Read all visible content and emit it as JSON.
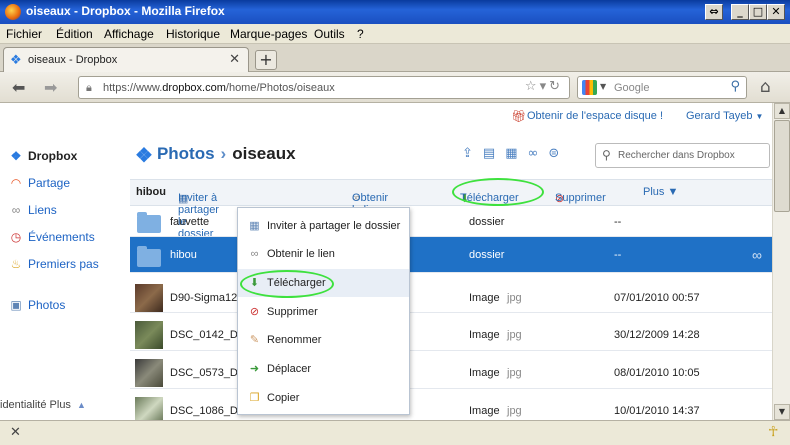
{
  "window": {
    "title": "oiseaux - Dropbox - Mozilla Firefox",
    "buttons": [
      "⇔",
      "_",
      "□",
      "✕"
    ]
  },
  "menu": [
    "Fichier",
    "Édition",
    "Affichage",
    "Historique",
    "Marque-pages",
    "Outils",
    "?"
  ],
  "tab": {
    "label": "oiseaux - Dropbox",
    "close": "✕",
    "new": "+"
  },
  "nav": {
    "url_prefix": "https://www.",
    "url_domain": "dropbox.com",
    "url_path": "/home/Photos/oiseaux",
    "search_placeholder": "Google"
  },
  "top": {
    "space_link": "Obtenir de l'espace disque !",
    "user": "Gerard Tayeb",
    "user_caret": "▼"
  },
  "sidebar": {
    "items": [
      {
        "label": "Dropbox",
        "icon": "dropbox-icon"
      },
      {
        "label": "Partage",
        "icon": "rainbow-icon"
      },
      {
        "label": "Liens",
        "icon": "link-icon"
      },
      {
        "label": "Événements",
        "icon": "clock-icon"
      },
      {
        "label": "Premiers pas",
        "icon": "cake-icon"
      },
      {
        "label": "Photos",
        "icon": "photo-icon"
      }
    ],
    "footer": "identialité Plus",
    "footer_caret": "▲"
  },
  "breadcrumb": {
    "root": "Photos",
    "sep": "›",
    "current": "oiseaux"
  },
  "search_dropbox_placeholder": "Rechercher dans Dropbox",
  "actionbar": {
    "selected": "hibou",
    "share": "Inviter à partager le dossier",
    "link": "Obtenir le lien",
    "download": "Télécharger",
    "delete": "Supprimer",
    "more": "Plus ▼"
  },
  "files": [
    {
      "name": "fauvette",
      "kind": "dossier",
      "ext": "",
      "date": "--",
      "type": "folder"
    },
    {
      "name": "hibou",
      "kind": "dossier",
      "ext": "",
      "date": "--",
      "type": "folder",
      "selected": true
    },
    {
      "name": "D90-Sigma120",
      "kind": "Image",
      "ext": "jpg",
      "date": "07/01/2010 00:57",
      "type": "image"
    },
    {
      "name": "DSC_0142_Dx6",
      "kind": "Image",
      "ext": "jpg",
      "date": "30/12/2009 14:28",
      "type": "image"
    },
    {
      "name": "DSC_0573_Dx6",
      "kind": "Image",
      "ext": "jpg",
      "date": "08/01/2010 10:05",
      "type": "image"
    },
    {
      "name": "DSC_1086_Dx6",
      "kind": "Image",
      "ext": "jpg",
      "date": "10/01/2010 14:37",
      "type": "image"
    }
  ],
  "context_menu": [
    {
      "label": "Inviter à partager le dossier",
      "icon": "share-icon"
    },
    {
      "label": "Obtenir le lien",
      "icon": "link-icon"
    },
    {
      "label": "Télécharger",
      "icon": "download-icon",
      "hover": true
    },
    {
      "label": "Supprimer",
      "icon": "delete-icon"
    },
    {
      "label": "Renommer",
      "icon": "rename-icon"
    },
    {
      "label": "Déplacer",
      "icon": "move-icon"
    },
    {
      "label": "Copier",
      "icon": "copy-icon"
    }
  ],
  "colors": {
    "link": "#2a6ab3",
    "selected_row": "#1f71c6",
    "highlight_ring": "#3ee13e"
  }
}
